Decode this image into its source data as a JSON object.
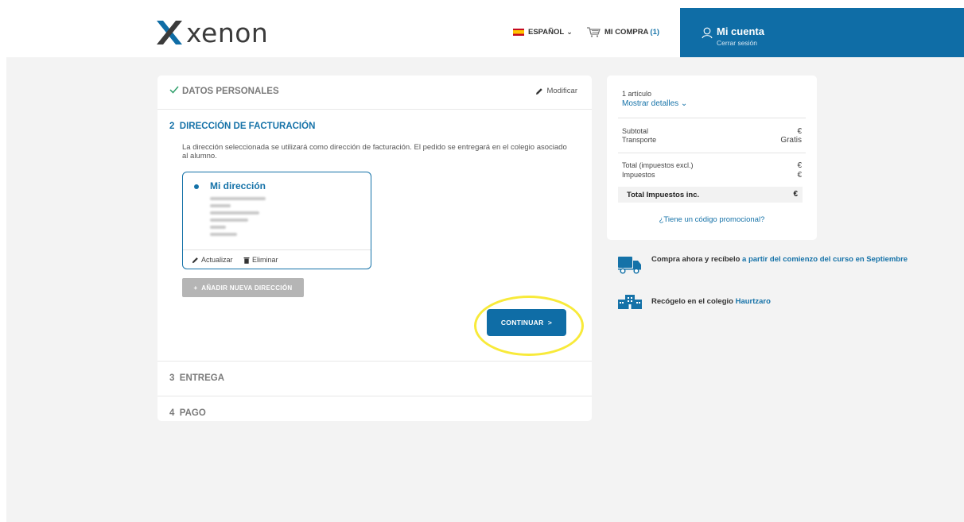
{
  "header": {
    "brand": "xenon",
    "language": "ESPAÑOL",
    "cart_label": "MI COMPRA",
    "cart_count": "(1)",
    "account_title": "Mi cuenta",
    "account_logout": "Cerrar sesión"
  },
  "checkout": {
    "step1": {
      "title": "DATOS PERSONALES",
      "modify_label": "Modificar"
    },
    "step2": {
      "title": "2  DIRECCIÓN DE FACTURACIÓN",
      "info": "La dirección seleccionada se utilizará como dirección de facturación. El pedido se entregará en el colegio asociado al alumno.",
      "address": {
        "name": "Mi dirección",
        "update_label": "Actualizar",
        "delete_label": "Eliminar"
      },
      "add_address_label": "+  AÑADIR NUEVA DIRECCIÓN",
      "continue_label": "CONTINUAR  >"
    },
    "step3": {
      "title": "3  ENTREGA"
    },
    "step4": {
      "title": "4  PAGO"
    }
  },
  "summary": {
    "items_count": "1 artículo",
    "show_details": "Mostrar detalles",
    "subtotal_label": "Subtotal",
    "subtotal_value": "€",
    "transport_label": "Transporte",
    "transport_value": "Gratis",
    "total_excl_label": "Total (impuestos excl.)",
    "total_excl_value": "€",
    "taxes_label": "Impuestos",
    "taxes_value": "€",
    "total_incl_label": "Total Impuestos inc.",
    "total_incl_value": "€",
    "promo_link": "¿Tiene un código promocional?"
  },
  "perks": {
    "shipping_text": "Compra ahora y recíbelo ",
    "shipping_highlight": "a partir del comienzo del curso en Septiembre",
    "pickup_text": "Recógelo en el colegio ",
    "pickup_highlight": "Haurtzaro"
  },
  "colors": {
    "brand_blue": "#0f6da6",
    "highlight": "#f8ea3a",
    "background": "#f3f3f3"
  },
  "icons": [
    "xenon-logo-icon",
    "spain-flag-icon",
    "chevron-down-icon",
    "cart-icon",
    "user-icon",
    "checkmark-icon",
    "pencil-icon",
    "trash-icon",
    "truck-icon",
    "school-building-icon"
  ]
}
